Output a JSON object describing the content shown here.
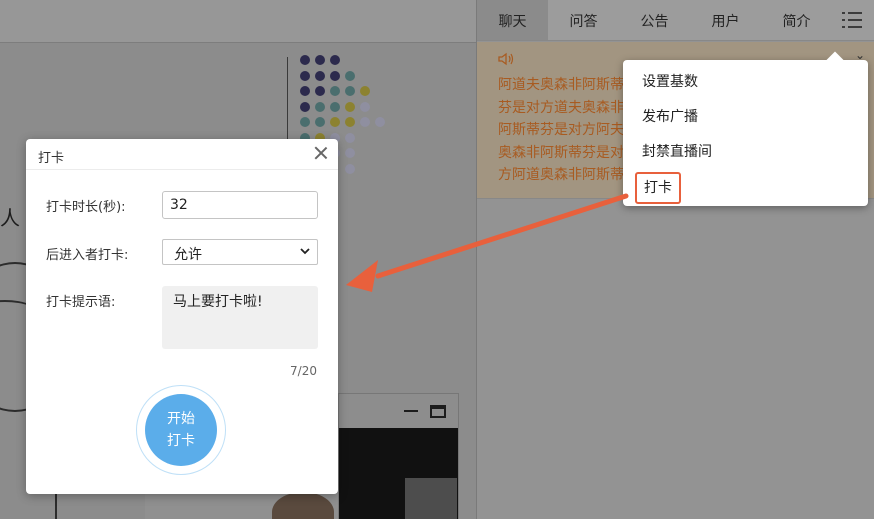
{
  "right_panel": {
    "tabs": [
      {
        "label": "聊天",
        "active": true
      },
      {
        "label": "问答",
        "active": false
      },
      {
        "label": "公告",
        "active": false
      },
      {
        "label": "用户",
        "active": false
      },
      {
        "label": "简介",
        "active": false
      }
    ],
    "menu_icon": "list-menu-icon",
    "notice": {
      "icon": "speaker-icon",
      "text": "阿道夫奥森非阿斯蒂芬是对方道夫奥森非阿斯蒂芬是对方阿夫奥森非阿斯蒂芬是对方阿道奥森非阿斯蒂芬是对方阿道夫森非阿"
    },
    "dropdown": {
      "items": [
        "设置基数",
        "发布广播",
        "封禁直播间",
        "打卡"
      ],
      "highlighted_item": "打卡",
      "highlight_color": "#e8603c"
    }
  },
  "slide": {
    "text_fragment": "人"
  },
  "dialog": {
    "title": "打卡",
    "duration": {
      "label": "打卡时长(秒):",
      "value": "32"
    },
    "late_checkin": {
      "label": "后进入者打卡:",
      "selected": "允许"
    },
    "prompt": {
      "label": "打卡提示语:",
      "value": "马上要打卡啦!",
      "count": "7/20"
    },
    "start_button": {
      "line1": "开始",
      "line2": "打卡",
      "color": "#5badea"
    }
  },
  "colors": {
    "arrow": "#e8603c",
    "notice_text": "#a85b21"
  }
}
